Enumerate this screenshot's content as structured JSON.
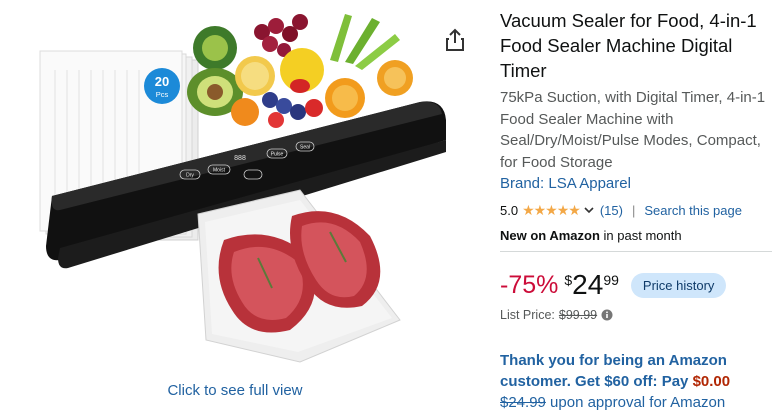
{
  "product": {
    "title": "Vacuum Sealer for Food, 4-in-1 Food Sealer Machine Digital Timer",
    "subtitle": "75kPa Suction, with Digital Timer, 4-in-1 Food Sealer Machine with Seal/Dry/Moist/Pulse Modes, Compact, for Food Storage",
    "brand": "Brand: LSA Apparel"
  },
  "rating": {
    "value": "5.0",
    "stars": "★★★★★",
    "stars_value": 5,
    "count": "(15)",
    "separator": "|",
    "search_link": "Search this page"
  },
  "badge": {
    "bold": "New on Amazon",
    "rest": " in past month"
  },
  "pricing": {
    "discount": "-75%",
    "currency": "$",
    "whole": "24",
    "fraction": "99",
    "history_button": "Price history",
    "list_label": "List Price:",
    "list_value": "$99.99"
  },
  "promo": {
    "line": "Thank you for being an Amazon customer. Get $60 off: Pay ",
    "pay_amount": "$0.00",
    "old_price": "$24.99",
    "suffix": " upon approval for Amazon"
  },
  "image": {
    "see_full": "Click to see full view",
    "bag_count": "20",
    "bag_unit": "Pcs",
    "buttons": [
      "Dry",
      "Moist",
      "Pulse",
      "Seal"
    ],
    "timer": "888"
  },
  "colors": {
    "link": "#2162a1",
    "discount": "#cc0c39",
    "star": "#f3a847",
    "price_history_bg": "#cfe6fb"
  }
}
